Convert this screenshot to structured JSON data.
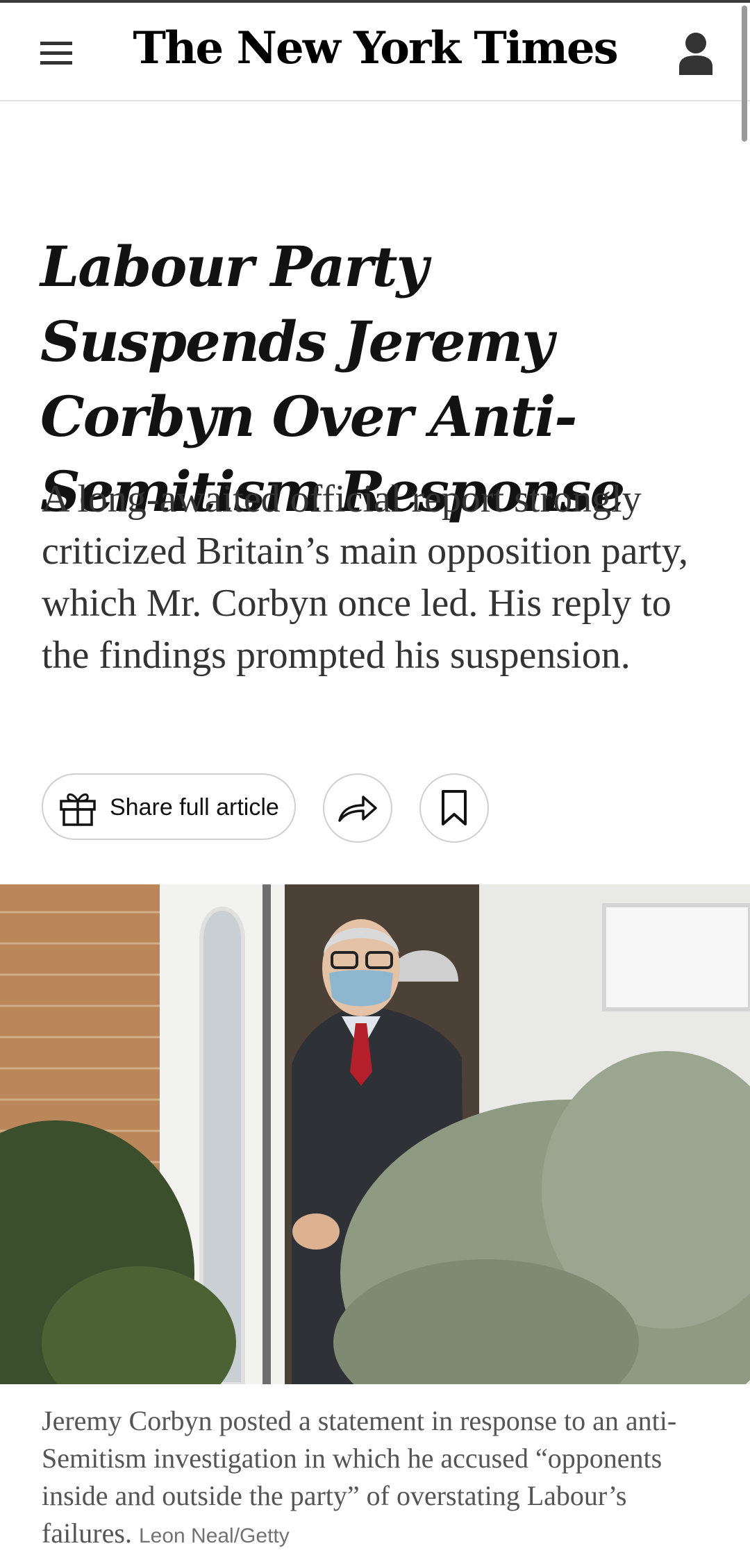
{
  "header": {
    "masthead": "The New York Times",
    "menu_icon": "hamburger-menu-icon",
    "account_icon": "user-account-icon"
  },
  "article": {
    "headline": "Labour Party Suspends Jeremy Corbyn Over Anti-Semitism Response",
    "summary": "A long-awaited official report strongly criticized Britain’s main opposition party, which Mr. Corbyn once led. His reply to the findings prompted his suspension.",
    "share_label": "Share full article",
    "share_icon": "gift-icon",
    "forward_icon": "share-arrow-icon",
    "bookmark_icon": "bookmark-icon",
    "caption": "Jeremy Corbyn posted a statement in response to an anti-Semitism investigation in which he accused  “opponents inside and outside the party” of overstating Labour’s failures.",
    "credit": "Leon Neal/Getty"
  },
  "colors": {
    "text": "#121212",
    "summary_text": "#333333",
    "caption_text": "#555555",
    "border": "#cfcfcf"
  }
}
